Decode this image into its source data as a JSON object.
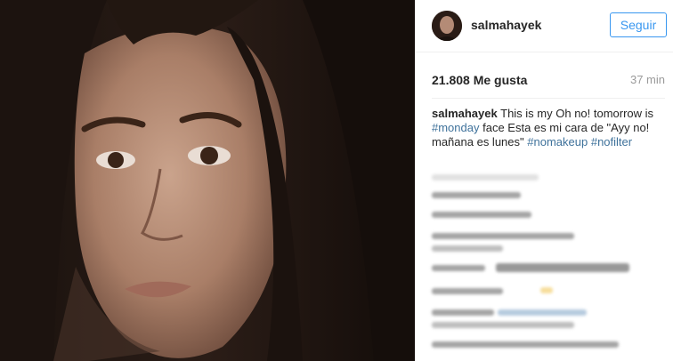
{
  "post": {
    "username": "salmahayek",
    "follow_label": "Seguir",
    "likes": "21.808 Me gusta",
    "time": "37 min",
    "caption": {
      "user": "salmahayek",
      "text_1": "This is my Oh no! tomorrow is",
      "tag_monday": "#monday",
      "text_2": "face Esta es mi cara de \"Ayy no! mañana es lunes\"",
      "tag_nomakeup": "#nomakeup",
      "tag_nofilter": "#nofilter"
    }
  },
  "colors": {
    "link_blue": "#3897f0",
    "hashtag": "#3f729b",
    "muted": "#9a9a9a"
  },
  "icons": {
    "avatar": "profile-avatar",
    "photo": "portrait-photo"
  }
}
